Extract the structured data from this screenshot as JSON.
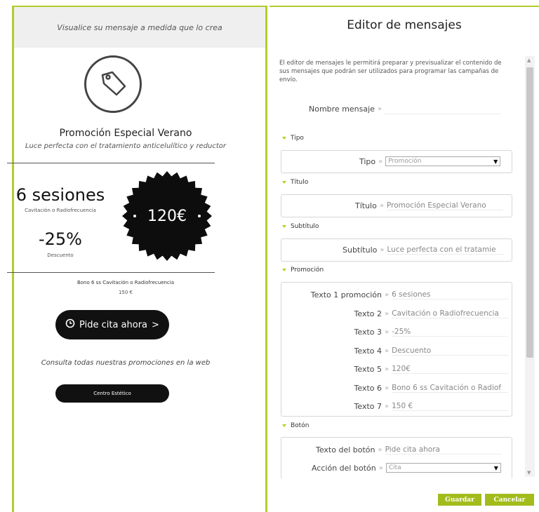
{
  "preview": {
    "header_text": "Visualice su mensaje a medida que lo crea",
    "title": "Promoción Especial Verano",
    "subtitle": "Luce perfecta con el tratamiento anticelulítico y reductor",
    "sessions": "6 sesiones",
    "sessions_sub": "Cavitación o Radiofrecuencia",
    "discount": "-25%",
    "discount_sub": "Descuento",
    "price": "120€",
    "bono": "Bono 6 ss Cavitación o Radiofrecuencia",
    "bono_price": "150 €",
    "cta_label": "Pide cita ahora",
    "cta_arrow": ">",
    "consulta": "Consulta todas nuestras promociones en la web",
    "centro_label": "Centro Estético"
  },
  "editor": {
    "title": "Editor de mensajes",
    "intro": "El editor de mensajes le permitirá preparar y previsualizar el contenido de sus mensajes que podrán ser utilizados para programar las campañas de envío.",
    "separator": "»",
    "nombre": {
      "label": "Nombre mensaje",
      "value": ""
    },
    "sections": {
      "tipo": "Tipo",
      "titulo": "Título",
      "subtitulo": "Subtítulo",
      "promocion": "Promoción",
      "boton": "Botón"
    },
    "tipo": {
      "label": "Tipo",
      "value": "Promoción"
    },
    "titulo": {
      "label": "Título",
      "value": "Promoción Especial Verano"
    },
    "subtitulo": {
      "label": "Subtítulo",
      "value": "Luce perfecta con el tratamie"
    },
    "promo_fields": [
      {
        "label": "Texto 1 promoción",
        "value": "6 sesiones"
      },
      {
        "label": "Texto 2",
        "value": "Cavitación o Radiofrecuencia"
      },
      {
        "label": "Texto 3",
        "value": "-25%"
      },
      {
        "label": "Texto 4",
        "value": "Descuento"
      },
      {
        "label": "Texto 5",
        "value": "120€"
      },
      {
        "label": "Texto 6",
        "value": "Bono 6 ss Cavitación o Radiof"
      },
      {
        "label": "Texto 7",
        "value": "150 €"
      }
    ],
    "boton_texto": {
      "label": "Texto del botón",
      "value": "Pide cita ahora"
    },
    "boton_accion": {
      "label": "Acción del botón",
      "value": "Cita"
    }
  },
  "actions": {
    "save": "Guardar",
    "cancel": "Cancelar"
  },
  "colors": {
    "accent": "#a3bc1c",
    "dark": "#111111"
  }
}
